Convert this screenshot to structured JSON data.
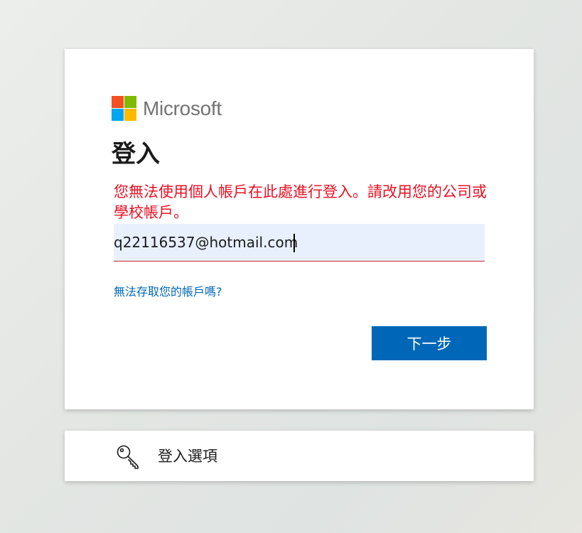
{
  "brand": {
    "name": "Microsoft",
    "colors": [
      "#f25022",
      "#7fba00",
      "#00a4ef",
      "#ffb900"
    ]
  },
  "signin": {
    "title": "登入",
    "error": "您無法使用個人帳戶在此處進行登入。請改用您的公司或學校帳戶。",
    "email_value": "q22116537@hotmail.com",
    "cant_access_link": "無法存取您的帳戶嗎?",
    "next_button": "下一步"
  },
  "options": {
    "icon": "key-icon",
    "label": "登入選項"
  },
  "colors": {
    "accent": "#0067b8",
    "error": "#e81123"
  }
}
